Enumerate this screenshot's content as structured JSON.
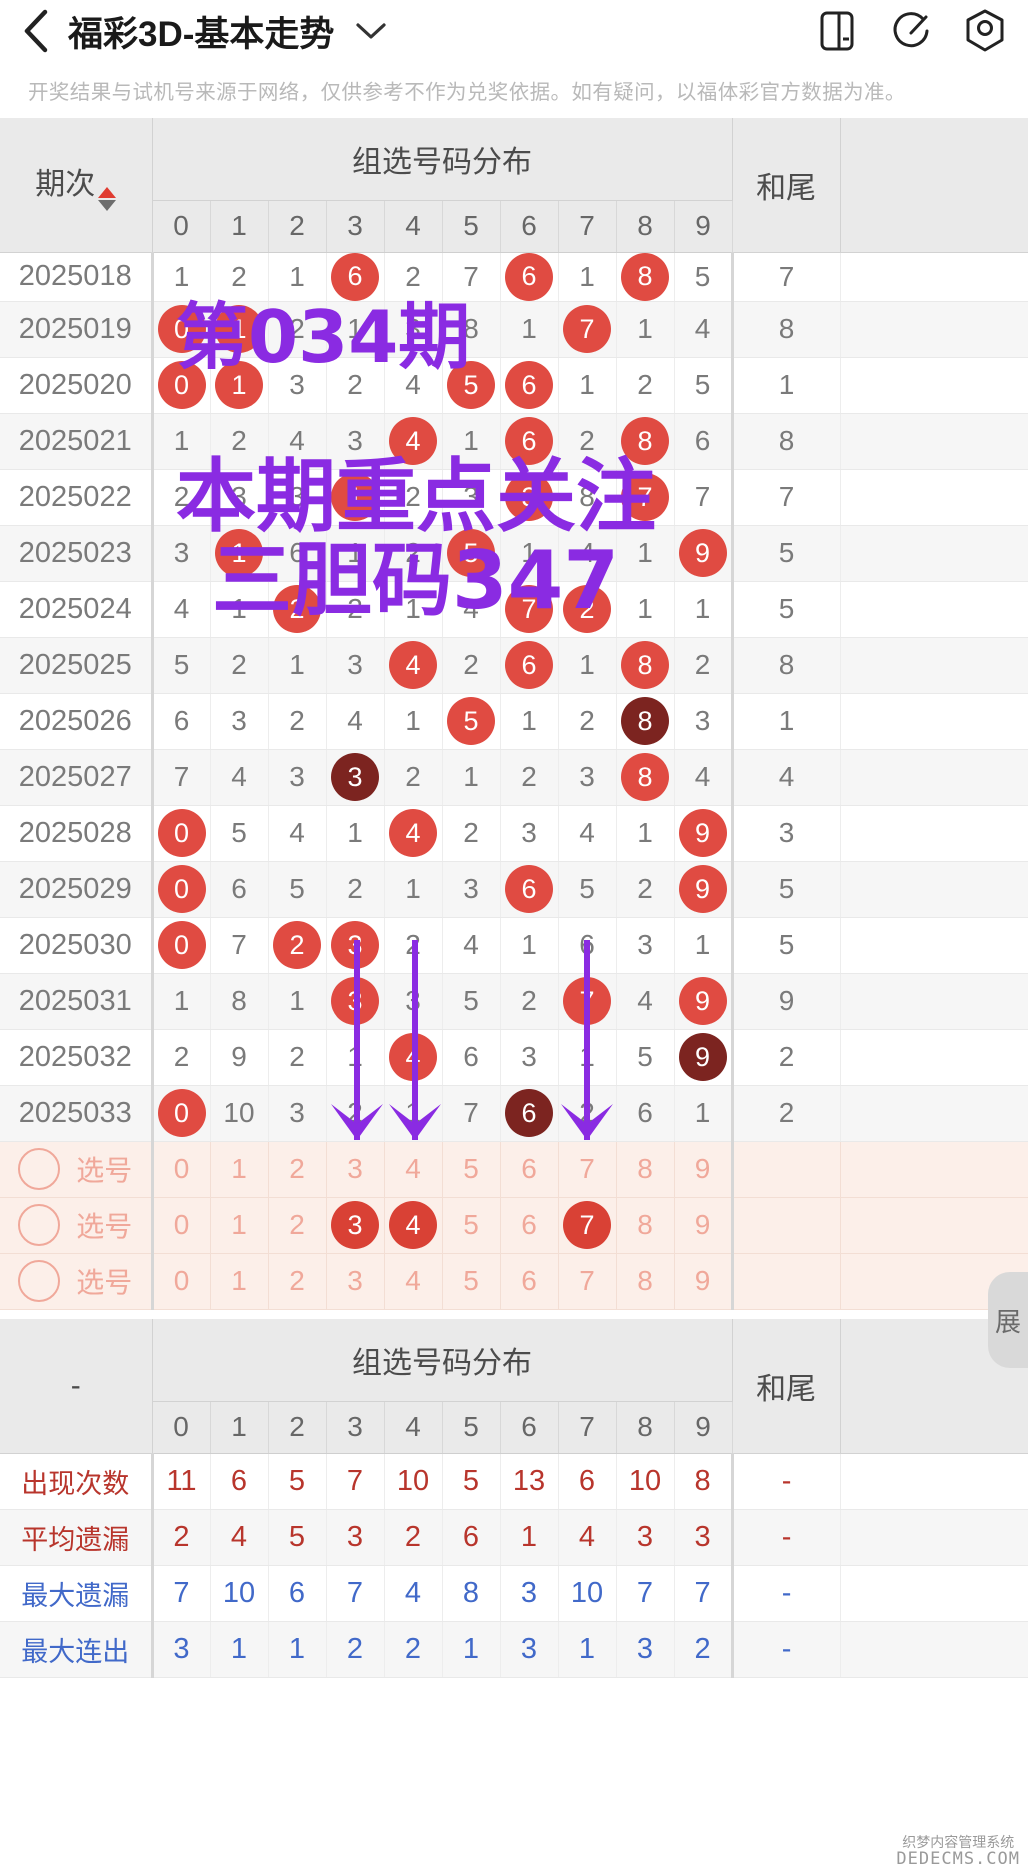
{
  "header": {
    "back_icon": "chevron-left-icon",
    "title": "福彩3D-基本走势",
    "dropdown_icon": "chevron-down-icon",
    "icons": [
      "split-screen-icon",
      "share-icon",
      "camera-icon"
    ]
  },
  "notice": "开奖结果与试机号来源于网络，仅供参考不作为兑奖依据。如有疑问，以福体彩官方数据为准。",
  "table": {
    "period_header": "期次",
    "group_header": "组选号码分布",
    "tail_header": "和尾",
    "digit_columns": [
      "0",
      "1",
      "2",
      "3",
      "4",
      "5",
      "6",
      "7",
      "8",
      "9"
    ],
    "foot_dash": "-",
    "expand_label": "展"
  },
  "chart_data": {
    "type": "table",
    "title": "福彩3D-基本走势 组选号码分布",
    "categories": [
      "0",
      "1",
      "2",
      "3",
      "4",
      "5",
      "6",
      "7",
      "8",
      "9"
    ],
    "rows": [
      {
        "period": "2025018",
        "cells": [
          "1",
          "2",
          "1",
          "6",
          "2",
          "7",
          "6",
          "1",
          "8",
          "5"
        ],
        "hits": [
          3,
          6,
          8
        ],
        "dark": [],
        "tail": "7",
        "clipped": true
      },
      {
        "period": "2025019",
        "cells": [
          "0",
          "1",
          "2",
          "1",
          "3",
          "8",
          "1",
          "7",
          "1",
          "4"
        ],
        "hits": [
          0,
          1,
          7
        ],
        "dark": [],
        "tail": "8"
      },
      {
        "period": "2025020",
        "cells": [
          "0",
          "1",
          "3",
          "2",
          "4",
          "5",
          "6",
          "1",
          "2",
          "5"
        ],
        "hits": [
          0,
          1,
          5,
          6
        ],
        "dark": [],
        "tail": "1"
      },
      {
        "period": "2025021",
        "cells": [
          "1",
          "2",
          "4",
          "3",
          "4",
          "1",
          "6",
          "2",
          "8",
          "6"
        ],
        "hits": [
          4,
          6,
          8
        ],
        "dark": [],
        "tail": "8"
      },
      {
        "period": "2025022",
        "cells": [
          "2",
          "3",
          "3",
          "1",
          "2",
          "3",
          "3",
          "8",
          "7",
          "7"
        ],
        "hits": [
          3,
          6,
          8
        ],
        "dark": [],
        "tail": "7"
      },
      {
        "period": "2025023",
        "cells": [
          "3",
          "1",
          "6",
          "1",
          "2",
          "5",
          "1",
          "4",
          "1",
          "9"
        ],
        "hits": [
          1,
          5,
          9
        ],
        "dark": [],
        "tail": "5"
      },
      {
        "period": "2025024",
        "cells": [
          "4",
          "1",
          "2",
          "2",
          "1",
          "4",
          "7",
          "2",
          "1",
          "1"
        ],
        "hits": [
          2,
          6,
          7
        ],
        "dark": [],
        "tail": "5"
      },
      {
        "period": "2025025",
        "cells": [
          "5",
          "2",
          "1",
          "3",
          "4",
          "2",
          "6",
          "1",
          "8",
          "2"
        ],
        "hits": [
          4,
          6,
          8
        ],
        "dark": [],
        "tail": "8"
      },
      {
        "period": "2025026",
        "cells": [
          "6",
          "3",
          "2",
          "4",
          "1",
          "5",
          "1",
          "2",
          "8",
          "3"
        ],
        "hits": [
          5,
          8
        ],
        "dark": [
          8
        ],
        "tail": "1"
      },
      {
        "period": "2025027",
        "cells": [
          "7",
          "4",
          "3",
          "3",
          "2",
          "1",
          "2",
          "3",
          "8",
          "4"
        ],
        "hits": [
          3,
          8
        ],
        "dark": [
          3
        ],
        "tail": "4"
      },
      {
        "period": "2025028",
        "cells": [
          "0",
          "5",
          "4",
          "1",
          "4",
          "2",
          "3",
          "4",
          "1",
          "9"
        ],
        "hits": [
          0,
          4,
          9
        ],
        "dark": [],
        "tail": "3"
      },
      {
        "period": "2025029",
        "cells": [
          "0",
          "6",
          "5",
          "2",
          "1",
          "3",
          "6",
          "5",
          "2",
          "9"
        ],
        "hits": [
          0,
          6,
          9
        ],
        "dark": [],
        "tail": "5"
      },
      {
        "period": "2025030",
        "cells": [
          "0",
          "7",
          "2",
          "3",
          "2",
          "4",
          "1",
          "6",
          "3",
          "1"
        ],
        "hits": [
          0,
          2,
          3
        ],
        "dark": [],
        "tail": "5"
      },
      {
        "period": "2025031",
        "cells": [
          "1",
          "8",
          "1",
          "3",
          "3",
          "5",
          "2",
          "7",
          "4",
          "9"
        ],
        "hits": [
          3,
          7,
          9
        ],
        "dark": [],
        "tail": "9"
      },
      {
        "period": "2025032",
        "cells": [
          "2",
          "9",
          "2",
          "1",
          "4",
          "6",
          "3",
          "1",
          "5",
          "9"
        ],
        "hits": [
          4,
          9
        ],
        "dark": [
          9
        ],
        "tail": "2"
      },
      {
        "period": "2025033",
        "cells": [
          "0",
          "10",
          "3",
          "2",
          "1",
          "7",
          "6",
          "2",
          "6",
          "1"
        ],
        "hits": [
          0,
          6
        ],
        "dark": [
          6
        ],
        "tail": "2"
      }
    ],
    "pick_rows": [
      {
        "label": "选号",
        "values": [
          "0",
          "1",
          "2",
          "3",
          "4",
          "5",
          "6",
          "7",
          "8",
          "9"
        ],
        "selected": []
      },
      {
        "label": "选号",
        "values": [
          "0",
          "1",
          "2",
          "3",
          "4",
          "5",
          "6",
          "7",
          "8",
          "9"
        ],
        "selected": [
          3,
          4,
          7
        ]
      },
      {
        "label": "选号",
        "values": [
          "0",
          "1",
          "2",
          "3",
          "4",
          "5",
          "6",
          "7",
          "8",
          "9"
        ],
        "selected": []
      }
    ],
    "stats": [
      {
        "label": "出现次数",
        "style": "red",
        "values": [
          "11",
          "6",
          "5",
          "7",
          "10",
          "5",
          "13",
          "6",
          "10",
          "8"
        ],
        "tail": "-"
      },
      {
        "label": "平均遗漏",
        "style": "red",
        "values": [
          "2",
          "4",
          "5",
          "3",
          "2",
          "6",
          "1",
          "4",
          "3",
          "3"
        ],
        "tail": "-"
      },
      {
        "label": "最大遗漏",
        "style": "blue",
        "values": [
          "7",
          "10",
          "6",
          "7",
          "4",
          "8",
          "3",
          "10",
          "7",
          "7"
        ],
        "tail": "-"
      },
      {
        "label": "最大连出",
        "style": "blue",
        "values": [
          "3",
          "1",
          "1",
          "2",
          "2",
          "1",
          "3",
          "1",
          "3",
          "2"
        ],
        "tail": "-"
      }
    ]
  },
  "annotations": {
    "line1": "第034期",
    "line2": "本期重点关注",
    "line3": "三胆码347",
    "color": "#8a2be2",
    "arrow_columns": [
      3,
      4,
      7
    ]
  },
  "watermark": {
    "line1": "织梦内容管理系统",
    "line2": "DEDECMS.COM"
  }
}
